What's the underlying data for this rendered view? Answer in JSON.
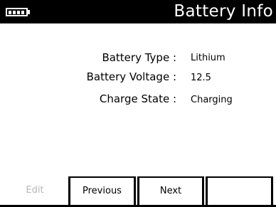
{
  "header": {
    "title": "Battery Info",
    "battery_icon": "battery-icon"
  },
  "fields": [
    {
      "label": "Battery Type :",
      "value": "Lithium"
    },
    {
      "label": "Battery Voltage :",
      "value": "12.5"
    },
    {
      "label": "Charge State :",
      "value": "Charging"
    }
  ],
  "softkeys": {
    "edit": {
      "label": "Edit",
      "state": "disabled"
    },
    "previous": {
      "label": "Previous",
      "state": "enabled"
    },
    "next": {
      "label": "Next",
      "state": "enabled"
    },
    "fourth": {
      "label": "",
      "state": "enabled"
    }
  },
  "colors": {
    "header_bg": "#000000",
    "header_text": "#ffffff",
    "disabled_text": "#b8b8b8"
  }
}
